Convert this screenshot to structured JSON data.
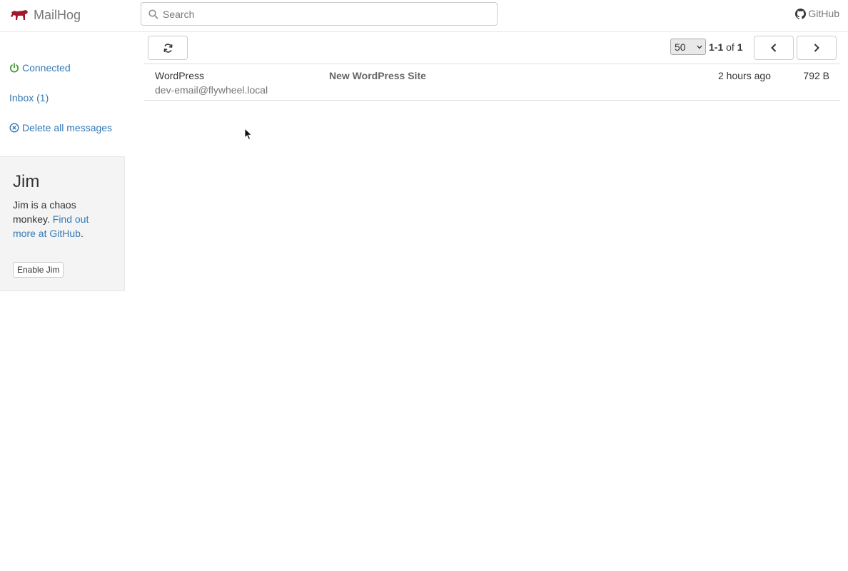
{
  "navbar": {
    "brand": "MailHog",
    "search_placeholder": "Search",
    "github_label": "GitHub"
  },
  "sidebar": {
    "connected_label": "Connected",
    "inbox_label": "Inbox (1)",
    "delete_label": "Delete all messages"
  },
  "jim": {
    "title": "Jim",
    "description": "Jim is a chaos monkey.",
    "link_text": "Find out more at GitHub",
    "link_suffix": ".",
    "button_label": "Enable Jim"
  },
  "toolbar": {
    "page_size": "50",
    "range": "1-1",
    "of_label": "of",
    "total": "1"
  },
  "messages": [
    {
      "from_name": "WordPress",
      "from_email": "dev-email@flywheel.local",
      "subject": "New WordPress Site",
      "time": "2 hours ago",
      "size": "792 B"
    }
  ],
  "colors": {
    "brand_icon": "#a0192b",
    "link": "#337ab7",
    "connected": "#3c9a2c"
  }
}
